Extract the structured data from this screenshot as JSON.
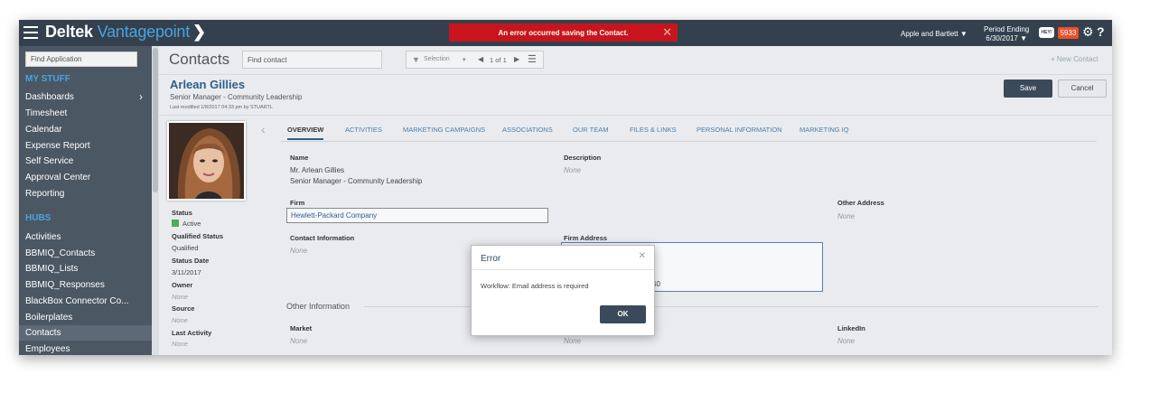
{
  "header": {
    "logo_brand": "Deltek",
    "logo_product": "Vantagepoint",
    "error_banner": "An error occurred saving the Contact.",
    "company": "Apple and Bartlett ▼",
    "period_label": "Period Ending",
    "period_date": "6/30/2017 ▼",
    "hey_label": "HEY!",
    "notification_count": "5933"
  },
  "sidebar": {
    "search_placeholder": "Find Application",
    "mystuff_heading": "MY STUFF",
    "mystuff_items": [
      "Dashboards",
      "Timesheet",
      "Calendar",
      "Expense Report",
      "Self Service",
      "Approval Center",
      "Reporting"
    ],
    "hubs_heading": "HUBS",
    "hubs_items": [
      "Activities",
      "BBMIQ_Contacts",
      "BBMIQ_Lists",
      "BBMIQ_Responses",
      "BlackBox Connector Co...",
      "Boilerplates",
      "Contacts",
      "Employees"
    ]
  },
  "main": {
    "title": "Contacts",
    "find_placeholder": "Find contact",
    "toolbar_selection": "Selection",
    "toolbar_page": "1 of 1",
    "new_contact": "New Contact",
    "contact_name": "Arlean Gillies",
    "contact_title": "Senior Manager - Community Leadership",
    "last_modified": "Last modified 1/8/2017 04:33 pm by STUARTL",
    "save_label": "Save",
    "cancel_label": "Cancel"
  },
  "profile": {
    "status_label": "Status",
    "status_value": "Active",
    "qualified_label": "Qualified Status",
    "qualified_value": "Qualified",
    "status_date_label": "Status Date",
    "status_date_value": "3/11/2017",
    "owner_label": "Owner",
    "owner_value": "None",
    "source_label": "Source",
    "source_value": "None",
    "last_activity_label": "Last Activity",
    "last_activity_value": "None"
  },
  "tabs": [
    "OVERVIEW",
    "ACTIVITIES",
    "MARKETING CAMPAIGNS",
    "ASSOCIATIONS",
    "OUR TEAM",
    "FILES & LINKS",
    "PERSONAL INFORMATION",
    "MARKETING IQ"
  ],
  "overview": {
    "name_label": "Name",
    "name_line1": "Mr. Arlean Gillies",
    "name_line2": "Senior Manager - Community Leadership",
    "description_label": "Description",
    "description_value": "None",
    "firm_label": "Firm",
    "firm_value": "Hewlett-Packard Company",
    "other_address_label": "Other Address",
    "other_address_value": "None",
    "contact_info_label": "Contact Information",
    "contact_info_value": "None",
    "firm_address_label": "Firm Address",
    "firm_address_partial": "40",
    "other_info_heading": "Other Information",
    "market_label": "Market",
    "market_value": "None",
    "middle_value": "None",
    "linkedin_label": "LinkedIn",
    "linkedin_value": "None"
  },
  "modal": {
    "title": "Error",
    "message": "Workflow: Email address is required",
    "ok_label": "OK"
  },
  "colors": {
    "topbar": "#34404d",
    "sidebar": "#4b5763",
    "accent": "#4aa3df",
    "error": "#c8151d",
    "primary_button": "#3b4a5a"
  }
}
